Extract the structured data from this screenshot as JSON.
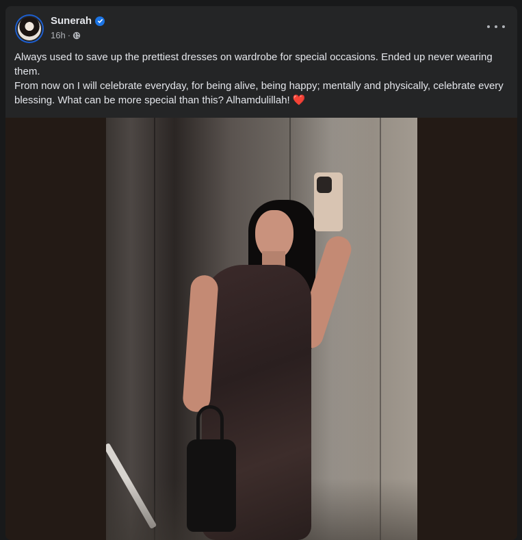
{
  "post": {
    "author": "Sunerah",
    "time": "16h",
    "separator": "·",
    "text_lines": [
      "Always used to save up the prettiest dresses on wardrobe for special occasions. Ended up never wearing them.",
      "From now on I will celebrate everyday, for being alive, being happy; mentally and physically, celebrate every blessing. What can be more special than this? Alhamdulillah!"
    ],
    "heart_emoji": "❤️"
  },
  "icons": {
    "verified": "verified-badge-icon",
    "audience": "globe-icon",
    "more": "more-options-icon"
  },
  "colors": {
    "background": "#18191a",
    "card": "#242526",
    "primary_text": "#e4e6eb",
    "secondary_text": "#b0b3b8",
    "verified_blue": "#1b74e4"
  }
}
